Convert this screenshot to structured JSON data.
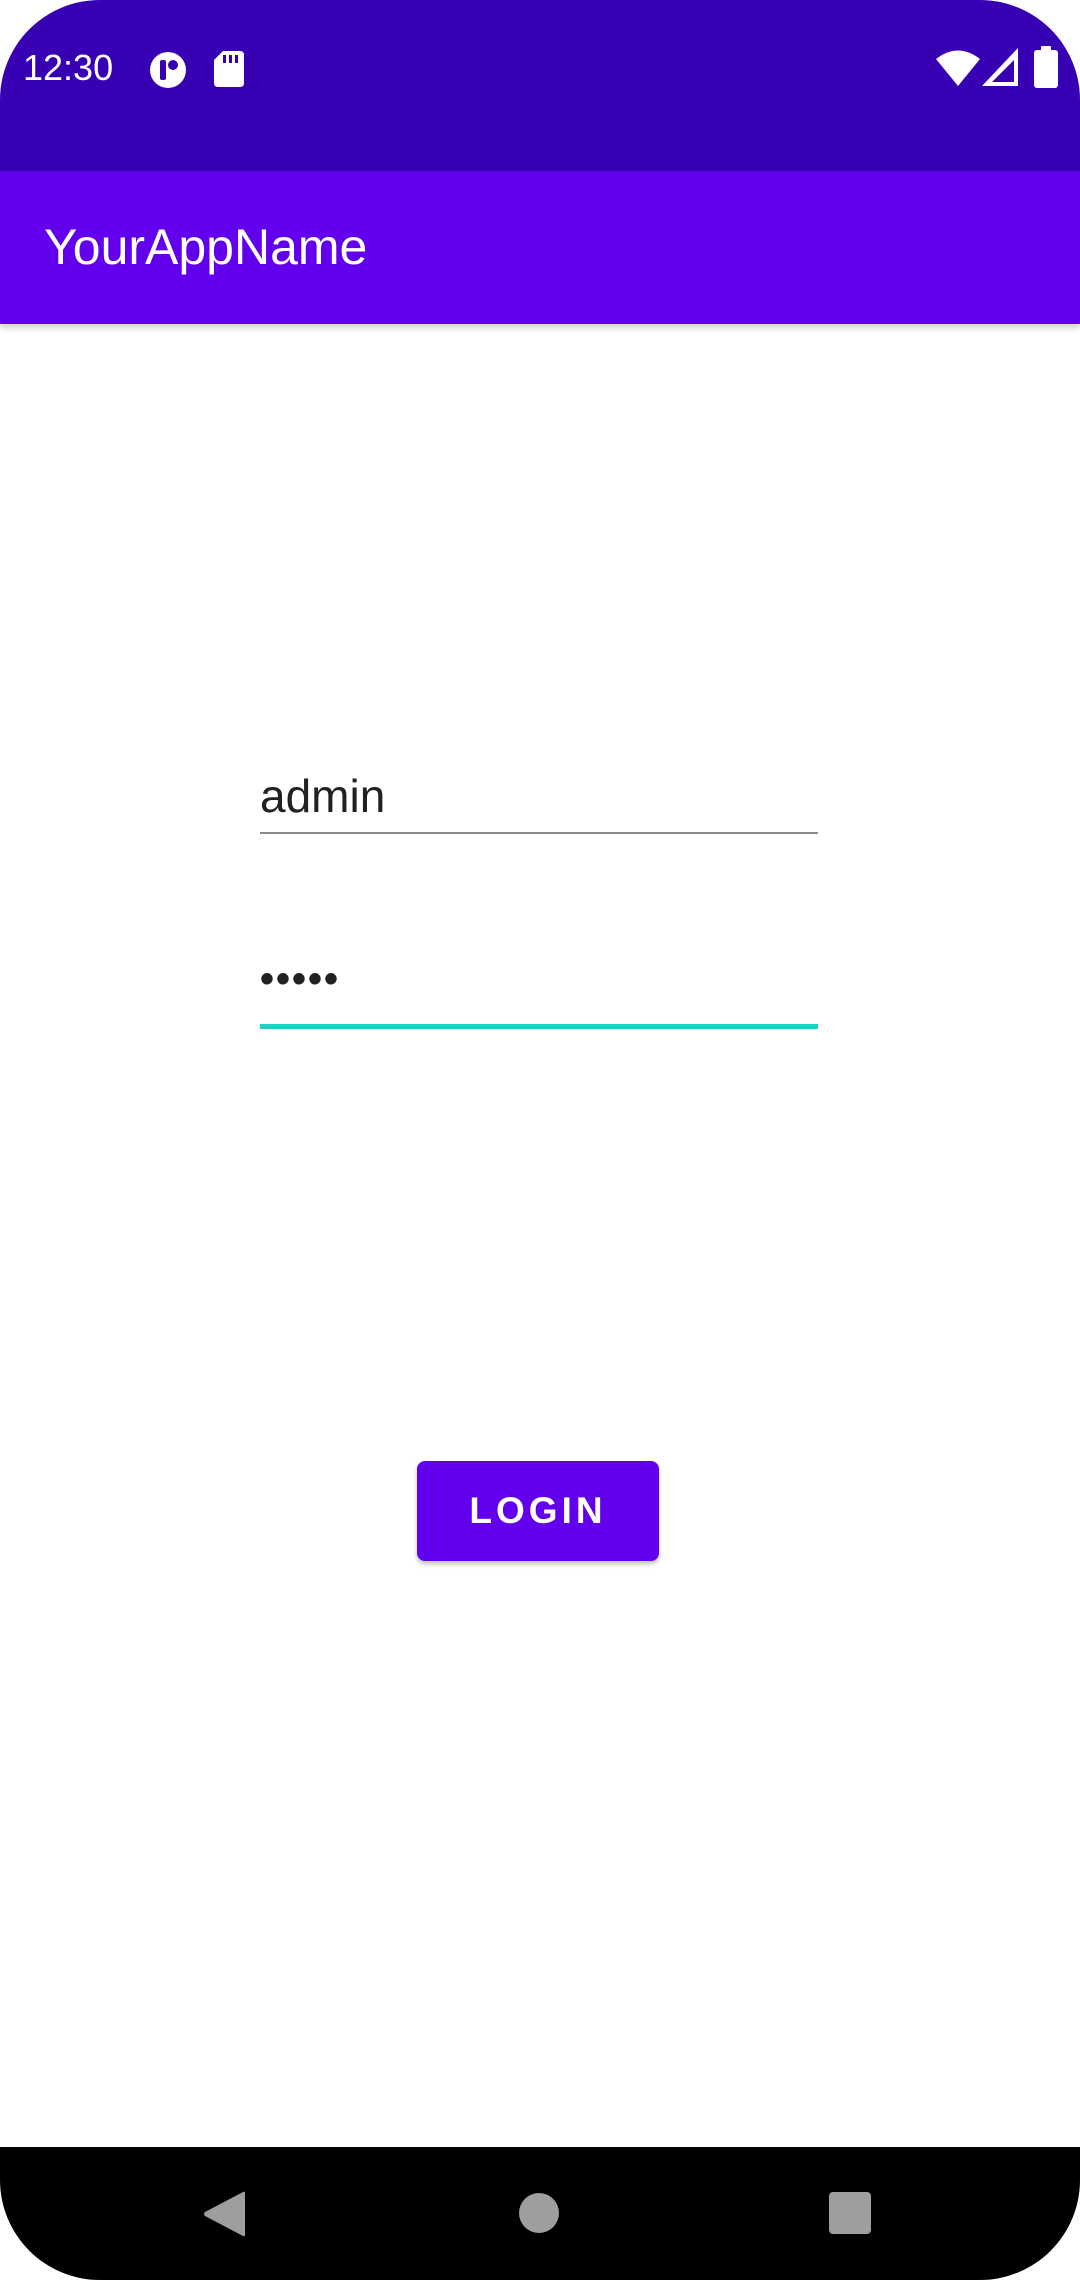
{
  "status_bar": {
    "time": "12:30",
    "background_color": "#3700B3",
    "left_icons": [
      "app-notification-icon",
      "sd-card-icon"
    ],
    "right_icons": [
      "wifi-icon",
      "cell-signal-icon",
      "battery-icon"
    ]
  },
  "app_bar": {
    "title": "YourAppName",
    "background_color": "#6200EE"
  },
  "login_form": {
    "username_value": "admin",
    "password_value": "•••••",
    "focused_field": "password",
    "focus_color": "#1ECFC3",
    "login_label": "LOGIN"
  },
  "nav_bar": {
    "buttons": [
      "back-icon",
      "home-icon",
      "recents-icon"
    ]
  }
}
